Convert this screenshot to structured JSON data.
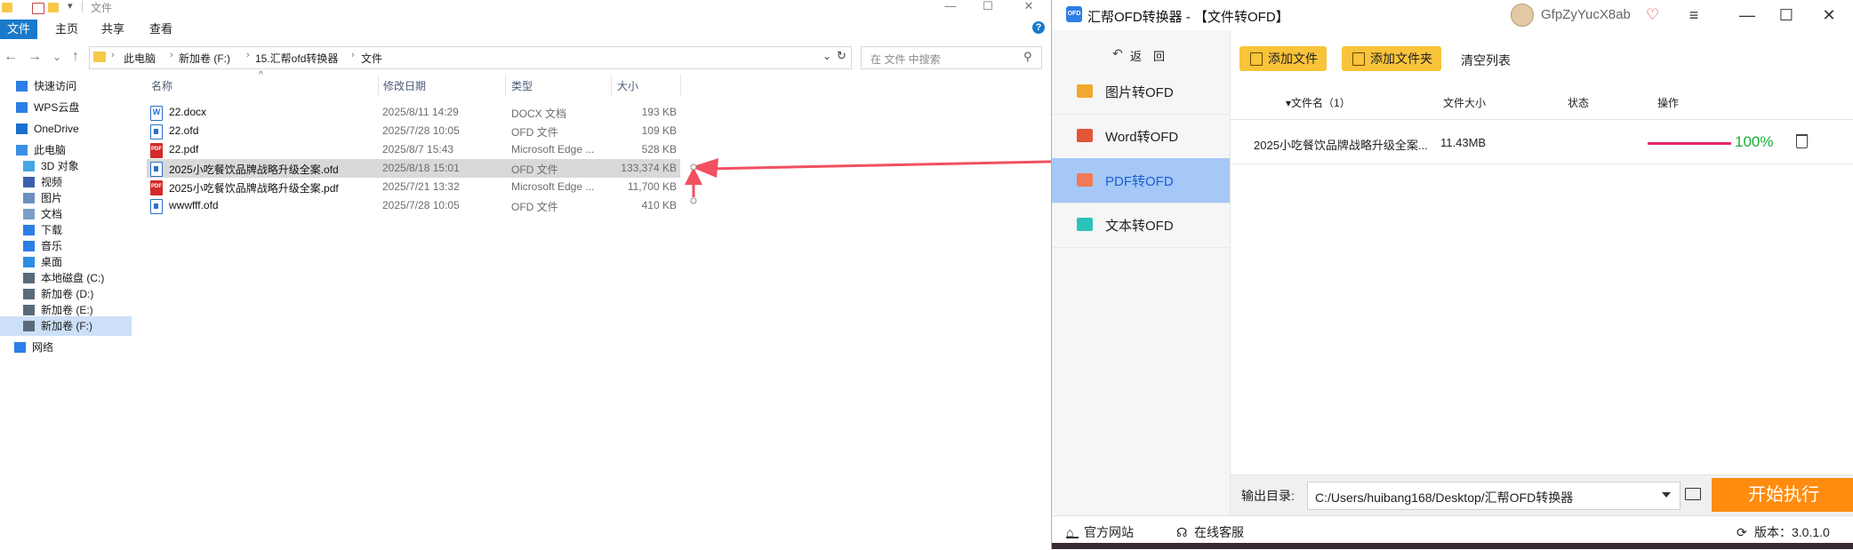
{
  "explorer": {
    "title": "文件",
    "window_controls": [
      "—",
      "☐",
      "✕"
    ],
    "ribbon": {
      "file_tab": "文件",
      "tabs": [
        "主页",
        "共享",
        "查看"
      ]
    },
    "nav_buttons": [
      "←",
      "→",
      "⌄",
      "↑"
    ],
    "breadcrumb": [
      "此电脑",
      "新加卷 (F:)",
      "15.汇帮ofd转换器",
      "文件"
    ],
    "search_placeholder": "在 文件 中搜索",
    "sidebar": [
      {
        "label": "快速访问",
        "icon": "star-icon",
        "color": "#2d7ee6"
      },
      {
        "label": "WPS云盘",
        "icon": "cloud-icon",
        "color": "#2d7ee6"
      },
      {
        "label": "OneDrive",
        "icon": "onedrive-icon",
        "color": "#1b6fd0"
      },
      {
        "label": "此电脑",
        "icon": "computer-icon",
        "color": "#3a8fe3"
      },
      {
        "label": "3D 对象",
        "icon": "cube-icon",
        "color": "#45a6e6"
      },
      {
        "label": "视频",
        "icon": "video-icon",
        "color": "#3a5fb0"
      },
      {
        "label": "图片",
        "icon": "pictures-icon",
        "color": "#6a8fc0"
      },
      {
        "label": "文档",
        "icon": "documents-icon",
        "color": "#7aa0c8"
      },
      {
        "label": "下载",
        "icon": "download-icon",
        "color": "#2d7ee6"
      },
      {
        "label": "音乐",
        "icon": "music-icon",
        "color": "#2d7ee6"
      },
      {
        "label": "桌面",
        "icon": "desktop-icon",
        "color": "#2d8ee6"
      },
      {
        "label": "本地磁盘 (C:)",
        "icon": "drive-icon",
        "color": "#5a6a7a"
      },
      {
        "label": "新加卷 (D:)",
        "icon": "drive-icon",
        "color": "#5a6a7a"
      },
      {
        "label": "新加卷 (E:)",
        "icon": "drive-icon",
        "color": "#5a6a7a"
      },
      {
        "label": "新加卷 (F:)",
        "icon": "drive-icon",
        "color": "#5a6a7a",
        "selected": true
      },
      {
        "label": "网络",
        "icon": "network-icon",
        "color": "#2d7ee6"
      }
    ],
    "columns": [
      "名称",
      "修改日期",
      "类型",
      "大小"
    ],
    "files": [
      {
        "name": "22.docx",
        "date": "2025/8/11 14:29",
        "type": "DOCX 文档",
        "size": "193 KB",
        "icon": "docx-file-icon"
      },
      {
        "name": "22.ofd",
        "date": "2025/7/28 10:05",
        "type": "OFD 文件",
        "size": "109 KB",
        "icon": "ofd-file-icon"
      },
      {
        "name": "22.pdf",
        "date": "2025/8/7 15:43",
        "type": "Microsoft Edge ...",
        "size": "528 KB",
        "icon": "pdf-file-icon"
      },
      {
        "name": "2025小吃餐饮品牌战略升级全案.ofd",
        "date": "2025/8/18 15:01",
        "type": "OFD 文件",
        "size": "133,374 KB",
        "icon": "ofd-file-icon",
        "selected": true
      },
      {
        "name": "2025小吃餐饮品牌战略升级全案.pdf",
        "date": "2025/7/21 13:32",
        "type": "Microsoft Edge ...",
        "size": "11,700 KB",
        "icon": "pdf-file-icon"
      },
      {
        "name": "wwwfff.ofd",
        "date": "2025/7/28 10:05",
        "type": "OFD 文件",
        "size": "410 KB",
        "icon": "ofd-file-icon"
      }
    ]
  },
  "app": {
    "logo_text": "OFD",
    "title": "汇帮OFD转换器 - 【文件转OFD】",
    "username": "GfpZyYucX8ab",
    "window_controls": [
      "≡",
      "—",
      "☐",
      "✕"
    ],
    "back_label": "返　回",
    "nav": [
      {
        "label": "图片转OFD",
        "icon": "image-icon",
        "color": "#f0a830"
      },
      {
        "label": "Word转OFD",
        "icon": "word-icon",
        "color": "#e2553a"
      },
      {
        "label": "PDF转OFD",
        "icon": "pdf-icon",
        "color": "#f07a55",
        "active": true
      },
      {
        "label": "文本转OFD",
        "icon": "text-icon",
        "color": "#2bc4b8"
      }
    ],
    "toolbar": {
      "add_file": "添加文件",
      "add_folder": "添加文件夹",
      "clear_list": "清空列表"
    },
    "table_headers": {
      "name": "文件名（1）",
      "size": "文件大小",
      "status": "状态",
      "action": "操作"
    },
    "rows": [
      {
        "name": "2025小吃餐饮品牌战略升级全案...",
        "size": "11.43MB",
        "progress": 1.0,
        "progress_label": "100%"
      }
    ],
    "output_label": "输出目录:",
    "output_path": "C:/Users/huibang168/Desktop/汇帮OFD转换器",
    "start_button": "开始执行",
    "footer": {
      "website": "官方网站",
      "support": "在线客服",
      "version": "版本：3.0.1.0"
    },
    "accent": "#f9c33a",
    "start_color": "#ff8c0f",
    "progress_color": "#e2295f"
  }
}
